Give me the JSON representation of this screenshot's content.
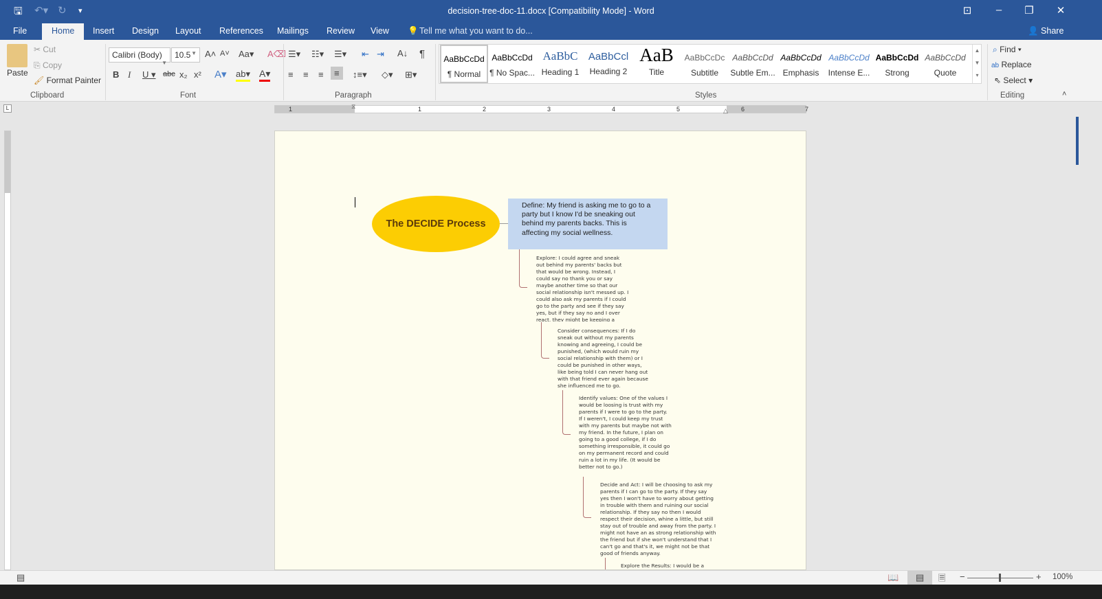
{
  "window": {
    "title": "decision-tree-doc-11.docx [Compatibility Mode] - Word"
  },
  "tabs": [
    "File",
    "Home",
    "Insert",
    "Design",
    "Layout",
    "References",
    "Mailings",
    "Review",
    "View"
  ],
  "tell_me": "Tell me what you want to do...",
  "share": "Share",
  "clipboard": {
    "paste": "Paste",
    "cut": "Cut",
    "copy": "Copy",
    "format_painter": "Format Painter",
    "label": "Clipboard"
  },
  "font": {
    "name": "Calibri (Body)",
    "size": "10.5",
    "label": "Font"
  },
  "paragraph": {
    "label": "Paragraph"
  },
  "styles": {
    "label": "Styles",
    "items": [
      {
        "preview": "AaBbCcDd",
        "name": "¶ Normal"
      },
      {
        "preview": "AaBbCcDd",
        "name": "¶ No Spac..."
      },
      {
        "preview": "AaBbC",
        "name": "Heading 1"
      },
      {
        "preview": "AaBbCcl",
        "name": "Heading 2"
      },
      {
        "preview": "AaB",
        "name": "Title"
      },
      {
        "preview": "AaBbCcDc",
        "name": "Subtitle"
      },
      {
        "preview": "AaBbCcDd",
        "name": "Subtle Em..."
      },
      {
        "preview": "AaBbCcDd",
        "name": "Emphasis"
      },
      {
        "preview": "AaBbCcDd",
        "name": "Intense E..."
      },
      {
        "preview": "AaBbCcDd",
        "name": "Strong"
      },
      {
        "preview": "AaBbCcDd",
        "name": "Quote"
      }
    ]
  },
  "editing": {
    "find": "Find",
    "replace": "Replace",
    "select": "Select",
    "label": "Editing"
  },
  "ruler": [
    "1",
    "1",
    "2",
    "3",
    "4",
    "5",
    "6",
    "7"
  ],
  "document": {
    "title": "The DECIDE Process",
    "define": "Define: My friend is asking me to go to a party but I know I'd be sneaking out behind my parents backs. This is affecting my social wellness.",
    "explore": "Explore: I could agree and sneak out behind my parents' backs but that would be wrong. Instead, I could say no thank you or say maybe another time so that our social relationship isn't messed up. I could also ask my parents if I could go to the party and see if they say yes, but if they say no and I over react, they might be keeping a closer watch on me.",
    "consider": "Consider consequences: If I do sneak out without my parents knowing and agreeing, I could be punished, (which would ruin my social relationship with them) or I could be punished in other ways, like being told I can never hang out with that friend ever again because she influenced me to go.",
    "identify": "Identify values: One of the values I would be loosing is trust with my parents if I were to go to the party. If I weren't, I could keep my trust with my parents but maybe not with my friend. In the future, I plan on going to a good college, if I do something irresponsible, it could go on my permanent record and could ruin a lot in my life. (It would be better not to go.)",
    "decide": "Decide and Act: I will be choosing to ask my parents if I can go to the party. If they say yes then I won't have to worry about getting in trouble with them and ruining our social relationship. If they say no then I would respect their decision, whine a little, but still stay out of trouble and away from the party. I might not have an as strong relationship with the friend but if she won't understand that I can't go and that's it, we might not be that good of friends anyway.",
    "evaluate": "Explore the Results: I would be a"
  },
  "status": {
    "zoom": "100%",
    "zoom_level": 100
  }
}
